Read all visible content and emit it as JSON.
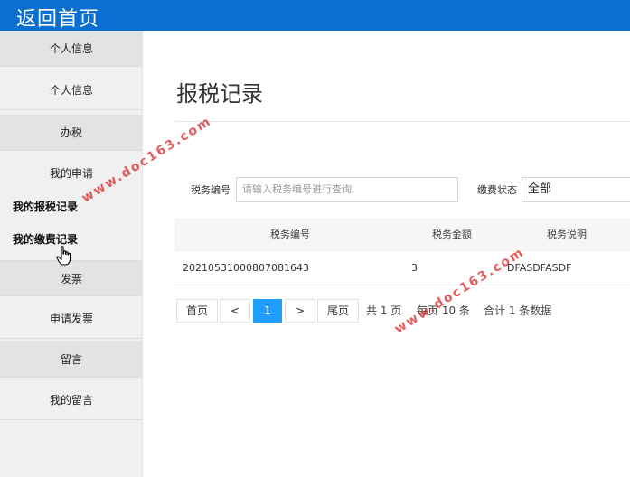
{
  "topbar": {
    "back_label": "返回首页"
  },
  "sidebar": {
    "items": [
      {
        "label": "个人信息",
        "kind": "category"
      },
      {
        "label": "个人信息",
        "kind": "link"
      },
      {
        "label": "办税",
        "kind": "category"
      },
      {
        "label": "我的申请",
        "kind": "link"
      },
      {
        "label": "我的报税记录",
        "kind": "sub"
      },
      {
        "label": "我的缴费记录",
        "kind": "sub"
      },
      {
        "label": "发票",
        "kind": "category"
      },
      {
        "label": "申请发票",
        "kind": "link"
      },
      {
        "label": "留言",
        "kind": "category"
      },
      {
        "label": "我的留言",
        "kind": "link"
      }
    ]
  },
  "main": {
    "title": "报税记录",
    "search": {
      "tax_no_label": "税务编号",
      "tax_no_placeholder": "请输入税务编号进行查询",
      "status_label": "缴费状态",
      "status_value": "全部"
    },
    "table": {
      "columns": [
        "税务编号",
        "税务金额",
        "税务说明"
      ],
      "rows": [
        [
          "20210531000807081643",
          "3",
          "DFASDFASDF"
        ]
      ]
    },
    "pagination": {
      "first": "首页",
      "prev": "<",
      "current": "1",
      "next": ">",
      "last": "尾页",
      "total_pages": "共 1 页",
      "per_page": "每页 10 条",
      "total": "合计 1 条数据"
    }
  },
  "watermark": {
    "text": "www.doc163.com"
  },
  "colors": {
    "topbar": "#0a6fd0",
    "accent": "#1e9fff",
    "watermark": "#dc2828"
  }
}
